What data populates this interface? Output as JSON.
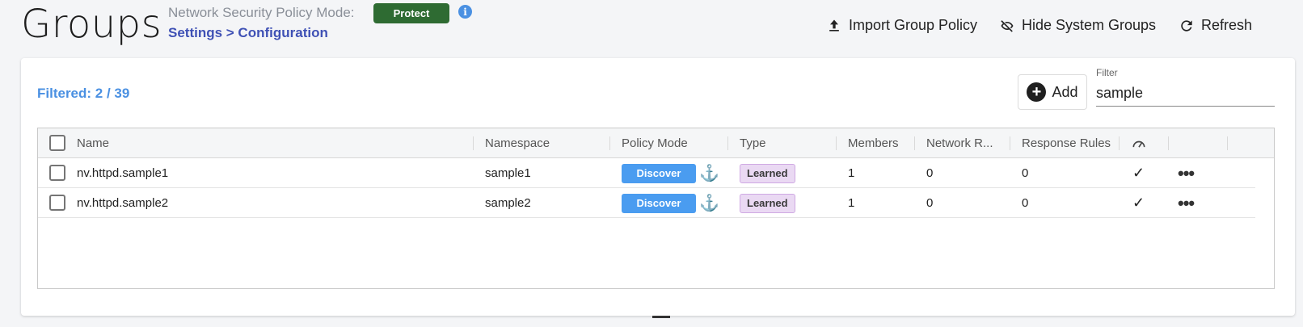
{
  "header": {
    "title": "Groups",
    "mode_label": "Network Security Policy Mode:",
    "mode_value": "Protect",
    "breadcrumb": "Settings > Configuration",
    "info_glyph": "i",
    "actions": {
      "import": "Import Group Policy",
      "hide_system": "Hide System Groups",
      "refresh": "Refresh"
    }
  },
  "toolbar": {
    "filtered_text": "Filtered: 2 / 39",
    "add_label": "Add",
    "filter_label": "Filter",
    "filter_value": "sample"
  },
  "table": {
    "columns": {
      "name": "Name",
      "namespace": "Namespace",
      "policy_mode": "Policy Mode",
      "type": "Type",
      "members": "Members",
      "network_rules": "Network R...",
      "response_rules": "Response Rules"
    },
    "rows": [
      {
        "name": "nv.httpd.sample1",
        "namespace": "sample1",
        "policy_mode": "Discover",
        "type": "Learned",
        "members": "1",
        "network_rules": "0",
        "response_rules": "0",
        "scored": "✓",
        "more": "•••"
      },
      {
        "name": "nv.httpd.sample2",
        "namespace": "sample2",
        "policy_mode": "Discover",
        "type": "Learned",
        "members": "1",
        "network_rules": "0",
        "response_rules": "0",
        "scored": "✓",
        "more": "•••"
      }
    ]
  },
  "icons": {
    "info": "info-icon",
    "upload": "upload-icon",
    "eye_off": "eye-off-icon",
    "refresh": "refresh-icon",
    "add": "add-circle-icon",
    "anchor": "anchor-icon",
    "gauge": "gauge-icon",
    "check": "check-icon",
    "more": "more-horizontal-icon"
  },
  "colors": {
    "protect_badge": "#2e6b32",
    "discover_pill": "#4a9cf0",
    "learned_pill": "#ead9f3",
    "breadcrumb": "#3f51b5",
    "filtered_text": "#4a90e2"
  }
}
